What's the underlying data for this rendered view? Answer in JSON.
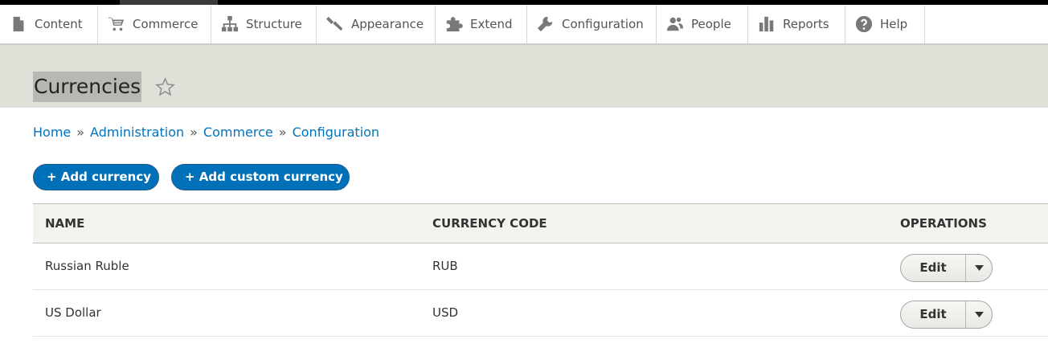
{
  "toolbar": {
    "items": [
      {
        "label": "Content",
        "icon": "file-icon"
      },
      {
        "label": "Commerce",
        "icon": "cart-icon"
      },
      {
        "label": "Structure",
        "icon": "sitemap-icon"
      },
      {
        "label": "Appearance",
        "icon": "paintbrush-icon"
      },
      {
        "label": "Extend",
        "icon": "puzzle-icon"
      },
      {
        "label": "Configuration",
        "icon": "wrench-icon"
      },
      {
        "label": "People",
        "icon": "people-icon"
      },
      {
        "label": "Reports",
        "icon": "bar-chart-icon"
      },
      {
        "label": "Help",
        "icon": "question-icon"
      }
    ]
  },
  "header": {
    "title": "Currencies"
  },
  "breadcrumb": [
    "Home",
    "Administration",
    "Commerce",
    "Configuration"
  ],
  "breadcrumb_separator": "»",
  "actions": {
    "add_currency": "+ Add currency",
    "add_custom_currency": "+ Add custom currency"
  },
  "table": {
    "headers": [
      "NAME",
      "CURRENCY CODE",
      "OPERATIONS"
    ],
    "rows": [
      {
        "name": "Russian Ruble",
        "code": "RUB",
        "operation": "Edit"
      },
      {
        "name": "US Dollar",
        "code": "USD",
        "operation": "Edit"
      }
    ]
  },
  "colors": {
    "link": "#0074bd",
    "primary_button": "#0071b8",
    "header_bg": "#e0e0d8",
    "table_header_bg": "#f3f3ee"
  }
}
